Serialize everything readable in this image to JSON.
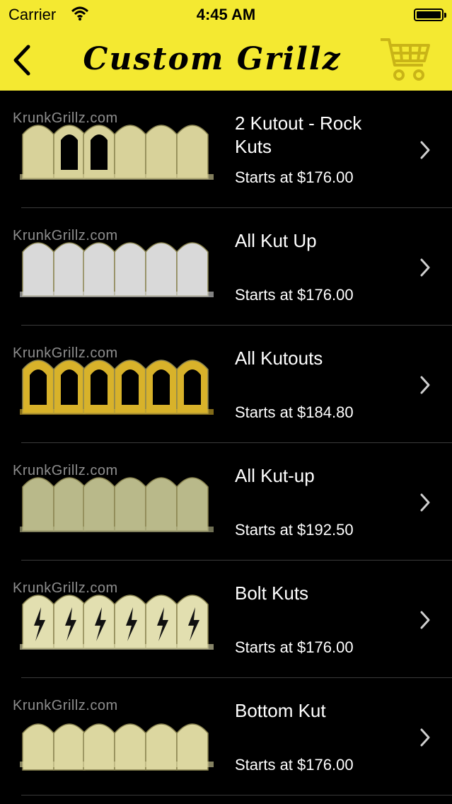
{
  "status_bar": {
    "carrier": "Carrier",
    "time": "4:45 AM"
  },
  "nav": {
    "title": "Custom Grillz",
    "back_icon": "chevron-left-icon",
    "cart_icon": "shopping-cart-icon"
  },
  "colors": {
    "header_bg": "#f4e931",
    "list_bg": "#000000",
    "text": "#ffffff"
  },
  "products": [
    {
      "name": "2 Kutout - Rock Kuts",
      "price": "Starts at $176.00",
      "watermark": "KrunkGrillz.com",
      "metal": "#d8d29a",
      "style": "kutout"
    },
    {
      "name": "All Kut Up",
      "price": "Starts at $176.00",
      "watermark": "KrunkGrillz.com",
      "metal": "#d9d9d9",
      "style": "solid"
    },
    {
      "name": "All Kutouts",
      "price": "Starts at $184.80",
      "watermark": "KrunkGrillz.com",
      "metal": "#d8b22a",
      "style": "open"
    },
    {
      "name": "All Kut-up",
      "price": "Starts at $192.50",
      "watermark": "KrunkGrillz.com",
      "metal": "#b9b98a",
      "style": "solid"
    },
    {
      "name": "Bolt Kuts",
      "price": "Starts at $176.00",
      "watermark": "KrunkGrillz.com",
      "metal": "#e2dfb0",
      "style": "bolt"
    },
    {
      "name": "Bottom Kut",
      "price": "Starts at $176.00",
      "watermark": "KrunkGrillz.com",
      "metal": "#dcd7a0",
      "style": "bottom"
    }
  ]
}
